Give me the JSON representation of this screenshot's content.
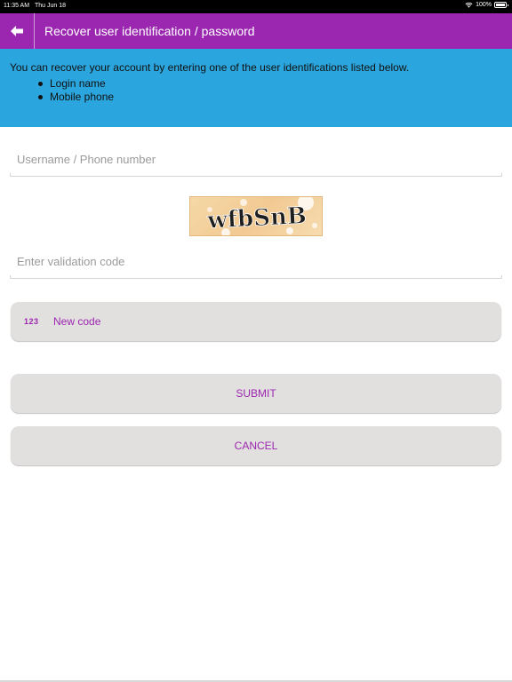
{
  "status_bar": {
    "time": "11:35 AM",
    "date": "Thu Jun 18",
    "battery": "100%"
  },
  "header": {
    "title": "Recover user identification / password"
  },
  "info": {
    "text": "You can recover your account by entering one of the user identifications listed below.",
    "items": [
      "Login name",
      "Mobile phone"
    ]
  },
  "form": {
    "username_placeholder": "Username / Phone number",
    "username_value": "",
    "captcha_text": "wfbSnB",
    "validation_placeholder": "Enter validation code",
    "validation_value": ""
  },
  "buttons": {
    "new_code_icon": "123",
    "new_code_label": "New code",
    "submit_label": "SUBMIT",
    "cancel_label": "CANCEL"
  },
  "colors": {
    "header": "#9b27b0",
    "info_panel": "#2ba5dd",
    "button_bg": "#e2dfdf",
    "button_text": "#9b27b0"
  },
  "icons": {
    "back": "arrow-left-icon",
    "wifi": "wifi-icon",
    "battery": "battery-icon",
    "captcha": "captcha-image"
  }
}
